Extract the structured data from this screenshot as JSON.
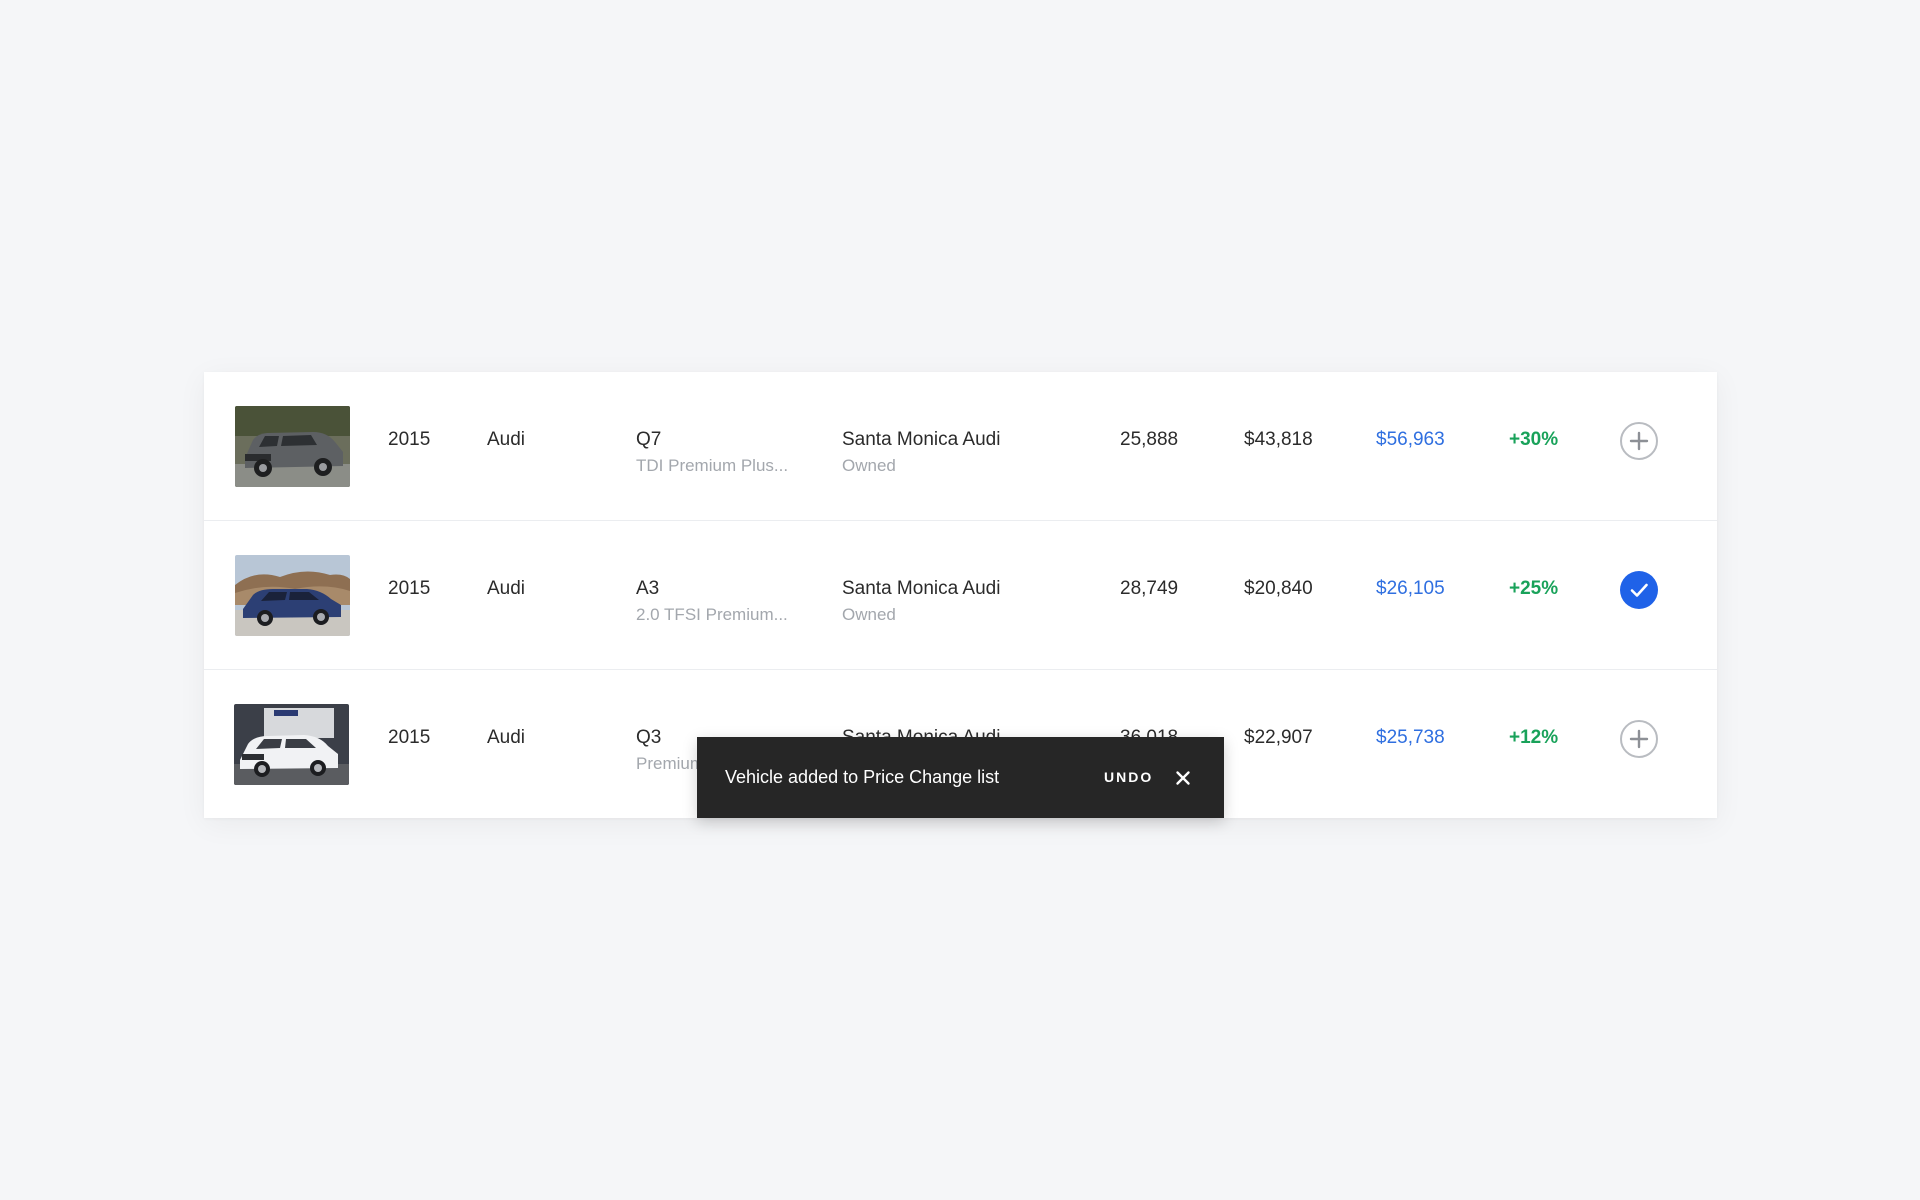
{
  "colors": {
    "background": "#f5f6f8",
    "price": "#2f6fe0",
    "increase": "#19a25a",
    "accent": "#1f62e8",
    "toast_bg": "#262626"
  },
  "vehicles": [
    {
      "year": "2015",
      "make": "Audi",
      "model": "Q7",
      "trim": "TDI Premium Plus...",
      "location": "Santa Monica Audi",
      "ownership": "Owned",
      "mileage": "25,888",
      "cost": "$43,818",
      "price": "$56,963",
      "change": "+30%",
      "action_icon": "plus-circle-icon",
      "selected": false
    },
    {
      "year": "2015",
      "make": "Audi",
      "model": "A3",
      "trim": "2.0 TFSI Premium...",
      "location": "Santa Monica Audi",
      "ownership": "Owned",
      "mileage": "28,749",
      "cost": "$20,840",
      "price": "$26,105",
      "change": "+25%",
      "action_icon": "check-circle-icon",
      "selected": true
    },
    {
      "year": "2015",
      "make": "Audi",
      "model": "Q3",
      "trim": "Premium",
      "location": "Santa Monica Audi",
      "ownership": "",
      "mileage": "36,018",
      "cost": "$22,907",
      "price": "$25,738",
      "change": "+12%",
      "action_icon": "plus-circle-icon",
      "selected": false
    }
  ],
  "toast": {
    "message": "Vehicle added to Price Change list",
    "undo_label": "UNDO",
    "close_icon": "close-icon"
  }
}
